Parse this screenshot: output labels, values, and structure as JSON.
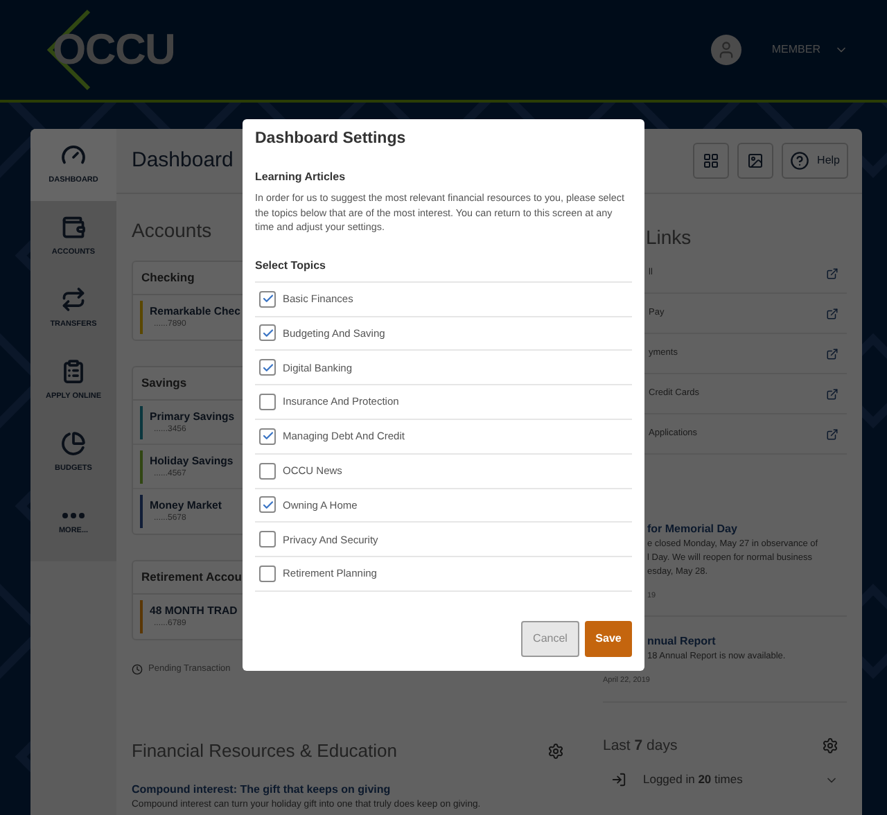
{
  "header": {
    "logo": "OCCU",
    "user": "MEMBER"
  },
  "sidebar": {
    "items": [
      {
        "label": "DASHBOARD",
        "selected": true
      },
      {
        "label": "ACCOUNTS",
        "selected": false
      },
      {
        "label": "TRANSFERS",
        "selected": false
      },
      {
        "label": "APPLY ONLINE",
        "selected": false
      },
      {
        "label": "BUDGETS",
        "selected": false
      },
      {
        "label": "MORE...",
        "selected": false
      }
    ]
  },
  "dashboard": {
    "title": "Dashboard",
    "help": "Help"
  },
  "accounts": {
    "title": "Accounts",
    "groups": [
      {
        "title": "Checking",
        "accounts": [
          {
            "name": "Remarkable Chec",
            "number": "......7890",
            "color": "#5a4700"
          }
        ]
      },
      {
        "title": "Savings",
        "accounts": [
          {
            "name": "Primary Savings",
            "number": "......3456",
            "color": "#0b373e"
          },
          {
            "name": "Holiday Savings",
            "number": "......4567",
            "color": "#314613"
          },
          {
            "name": "Money Market",
            "number": "......5678",
            "color": "#111e38"
          }
        ]
      },
      {
        "title": "Retirement Accou",
        "accounts": [
          {
            "name": "48 MONTH TRAD",
            "number": "......6789",
            "color": "#5a3706"
          }
        ]
      }
    ],
    "legend": "Pending Transaction"
  },
  "links": {
    "title": "Links",
    "items": [
      "ll",
      "Pay",
      "yments",
      "Credit Cards",
      "Applications"
    ]
  },
  "news": [
    {
      "title": "for Memorial Day",
      "body": [
        "e closed Monday, May 27 in observance of",
        "l Day. We will reopen for normal business",
        "esday, May 28."
      ],
      "date": "19"
    },
    {
      "title": "nnual Report",
      "body": [
        "18 Annual Report is now available."
      ],
      "date": "April 22, 2019"
    }
  ],
  "resources": {
    "title": "Financial Resources & Education",
    "article_title": "Compound interest: The gift that keeps on giving",
    "article_body": "Compound interest can turn your holiday gift into one that truly does keep on giving."
  },
  "activity": {
    "title": "Last **7** days",
    "item": "Logged in **20** times"
  },
  "modal": {
    "title": "Dashboard Settings",
    "section": "Learning Articles",
    "description": "In order for us to suggest the most relevant financial resources to you, please select the topics below that are of the most interest. You can return to this screen at any time and adjust your settings.",
    "topics_label": "Select Topics",
    "topics": [
      {
        "label": "Basic Finances",
        "checked": true
      },
      {
        "label": "Budgeting And Saving",
        "checked": true
      },
      {
        "label": "Digital Banking",
        "checked": true
      },
      {
        "label": "Insurance And Protection",
        "checked": false
      },
      {
        "label": "Managing Debt And Credit",
        "checked": true
      },
      {
        "label": "OCCU News",
        "checked": false
      },
      {
        "label": "Owning A Home",
        "checked": true
      },
      {
        "label": "Privacy And Security",
        "checked": false
      },
      {
        "label": "Retirement Planning",
        "checked": false
      }
    ],
    "cancel": "Cancel",
    "save": "Save"
  }
}
